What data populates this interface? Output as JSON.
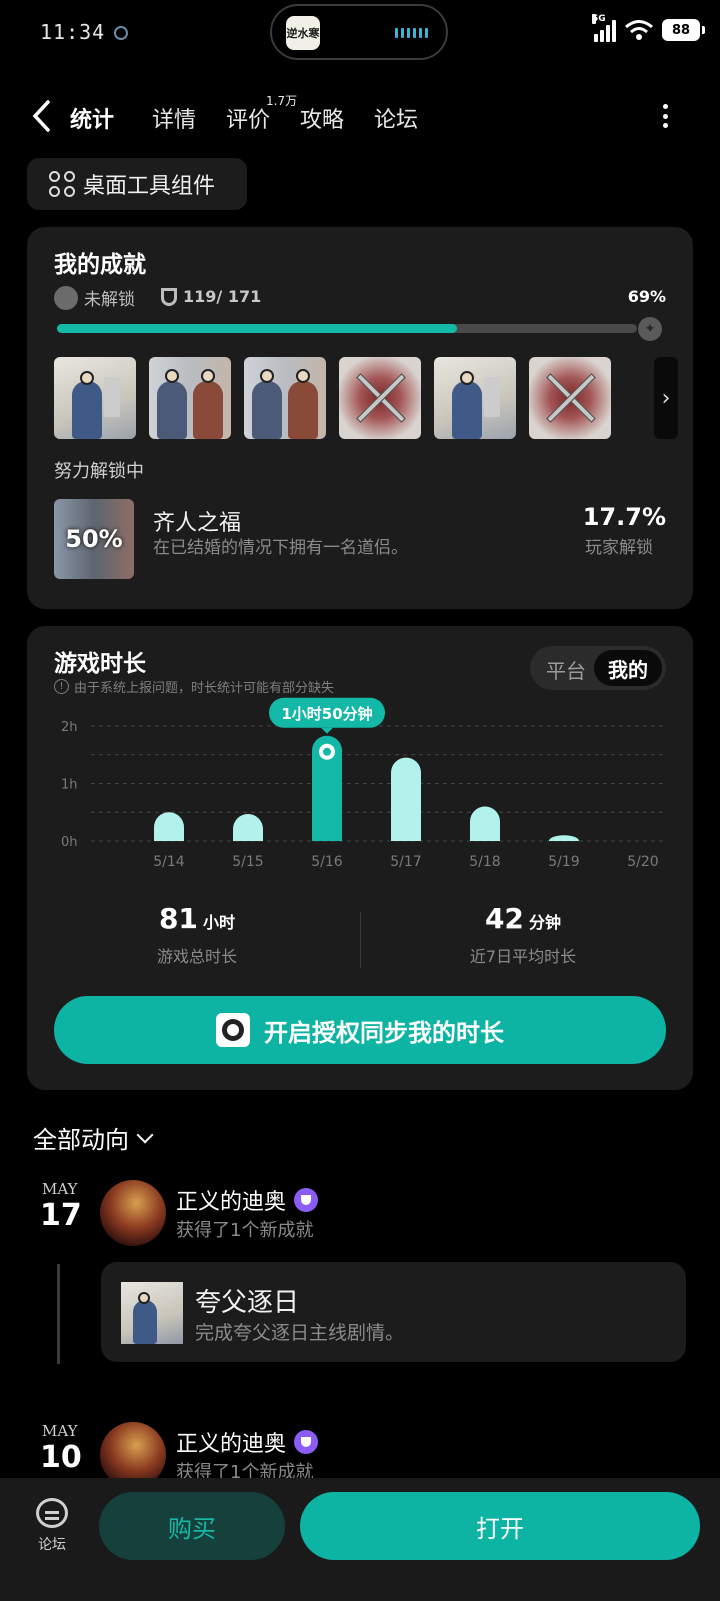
{
  "status": {
    "time": "11:34",
    "network": "5G",
    "battery": "88",
    "island_app_text": "逆水寒"
  },
  "nav": {
    "tabs": [
      {
        "label": "统计"
      },
      {
        "label": "详情"
      },
      {
        "label": "评价"
      },
      {
        "label": "攻略"
      },
      {
        "label": "论坛"
      }
    ],
    "review_count": "1.7万"
  },
  "widget_button": "桌面工具组件",
  "achievements": {
    "title": "我的成就",
    "unlock_label": "未解锁",
    "count": "119/ 171",
    "percent_text": "69%",
    "progress": 0.69,
    "working_label": "努力解锁中",
    "working": {
      "percent": "50%",
      "title": "齐人之福",
      "desc": "在已结婚的情况下拥有一名道侣。",
      "rate": "17.7%",
      "rate_label": "玩家解锁"
    }
  },
  "playtime": {
    "title": "游戏时长",
    "note": "由于系统上报问题，时长统计可能有部分缺失",
    "segment": {
      "platform": "平台",
      "mine": "我的"
    },
    "tooltip": "1小时50分钟",
    "total_value": "81",
    "total_unit": "小时",
    "total_label": "游戏总时长",
    "avg_value": "42",
    "avg_unit": "分钟",
    "avg_label": "近7日平均时长",
    "sync_button": "开启授权同步我的时长"
  },
  "chart_data": {
    "type": "bar",
    "categories": [
      "5/14",
      "5/15",
      "5/16",
      "5/17",
      "5/18",
      "5/19",
      "5/20"
    ],
    "values": [
      0.5,
      0.47,
      1.83,
      1.45,
      0.6,
      0.1,
      0
    ],
    "yticks": [
      "0h",
      "1h",
      "2h"
    ],
    "ylim": [
      0,
      2
    ],
    "highlight_index": 2,
    "grid": true,
    "colors": {
      "bar": "#b2f2ec",
      "highlight": "#14b8a6"
    }
  },
  "feed": {
    "filter": "全部动向",
    "items": [
      {
        "month": "MAY",
        "day": "17",
        "user": "正义的迪奥",
        "action": "获得了1个新成就",
        "card_title": "夸父逐日",
        "card_desc": "完成夸父逐日主线剧情。"
      },
      {
        "month": "MAY",
        "day": "10",
        "user": "正义的迪奥",
        "action": "获得了1个新成就"
      }
    ]
  },
  "bottom": {
    "forum": "论坛",
    "buy": "购买",
    "open": "打开"
  },
  "colors": {
    "accent": "#14b8a6",
    "card_bg": "#1c1c1c",
    "badge": "#8b5cf6"
  }
}
